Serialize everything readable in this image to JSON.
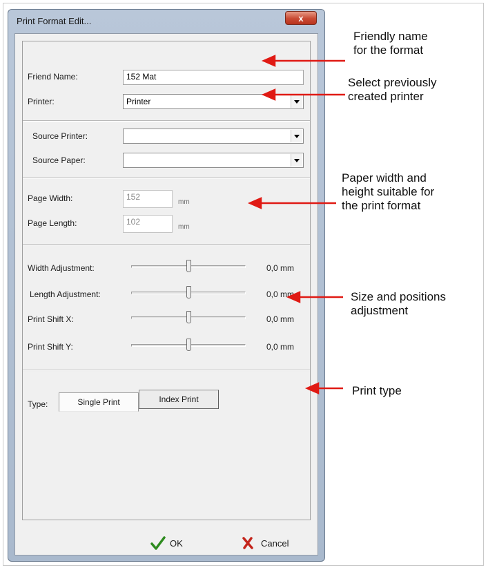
{
  "dialog": {
    "title": "Print Format Edit...",
    "close_label": "x",
    "fields": {
      "friend_name": {
        "label": "Friend Name:",
        "value": "152 Mat"
      },
      "printer": {
        "label": "Printer:",
        "value": "Printer"
      },
      "source_printer": {
        "label": "Source Printer:",
        "value": ""
      },
      "source_paper": {
        "label": "Source Paper:",
        "value": ""
      },
      "page_width": {
        "label": "Page Width:",
        "value": "152",
        "unit": "mm"
      },
      "page_length": {
        "label": "Page Length:",
        "value": "102",
        "unit": "mm"
      }
    },
    "sliders": [
      {
        "label": "Width Adjustment:",
        "value": "0,0 mm",
        "position": 0.5
      },
      {
        "label": "Length Adjustment:",
        "value": "0,0 mm",
        "position": 0.5
      },
      {
        "label": "Print Shift X:",
        "value": "0,0 mm",
        "position": 0.5
      },
      {
        "label": "Print Shift Y:",
        "value": "0,0 mm",
        "position": 0.5
      }
    ],
    "type": {
      "label": "Type:",
      "options": [
        "Single Print",
        "Index Print"
      ],
      "selected": "Single Print"
    },
    "buttons": {
      "ok": "OK",
      "cancel": "Cancel"
    }
  },
  "annotations": [
    "Friendly name\nfor the format",
    "Select previously\ncreated printer",
    "Paper width and\nheight suitable for\nthe print format",
    "Size and positions\nadjustment",
    "Print type"
  ],
  "colors": {
    "ok_check": "#2e8b1f",
    "cancel_x": "#c4241b",
    "arrow": "#e01a14",
    "close_button": "#c94b34"
  }
}
